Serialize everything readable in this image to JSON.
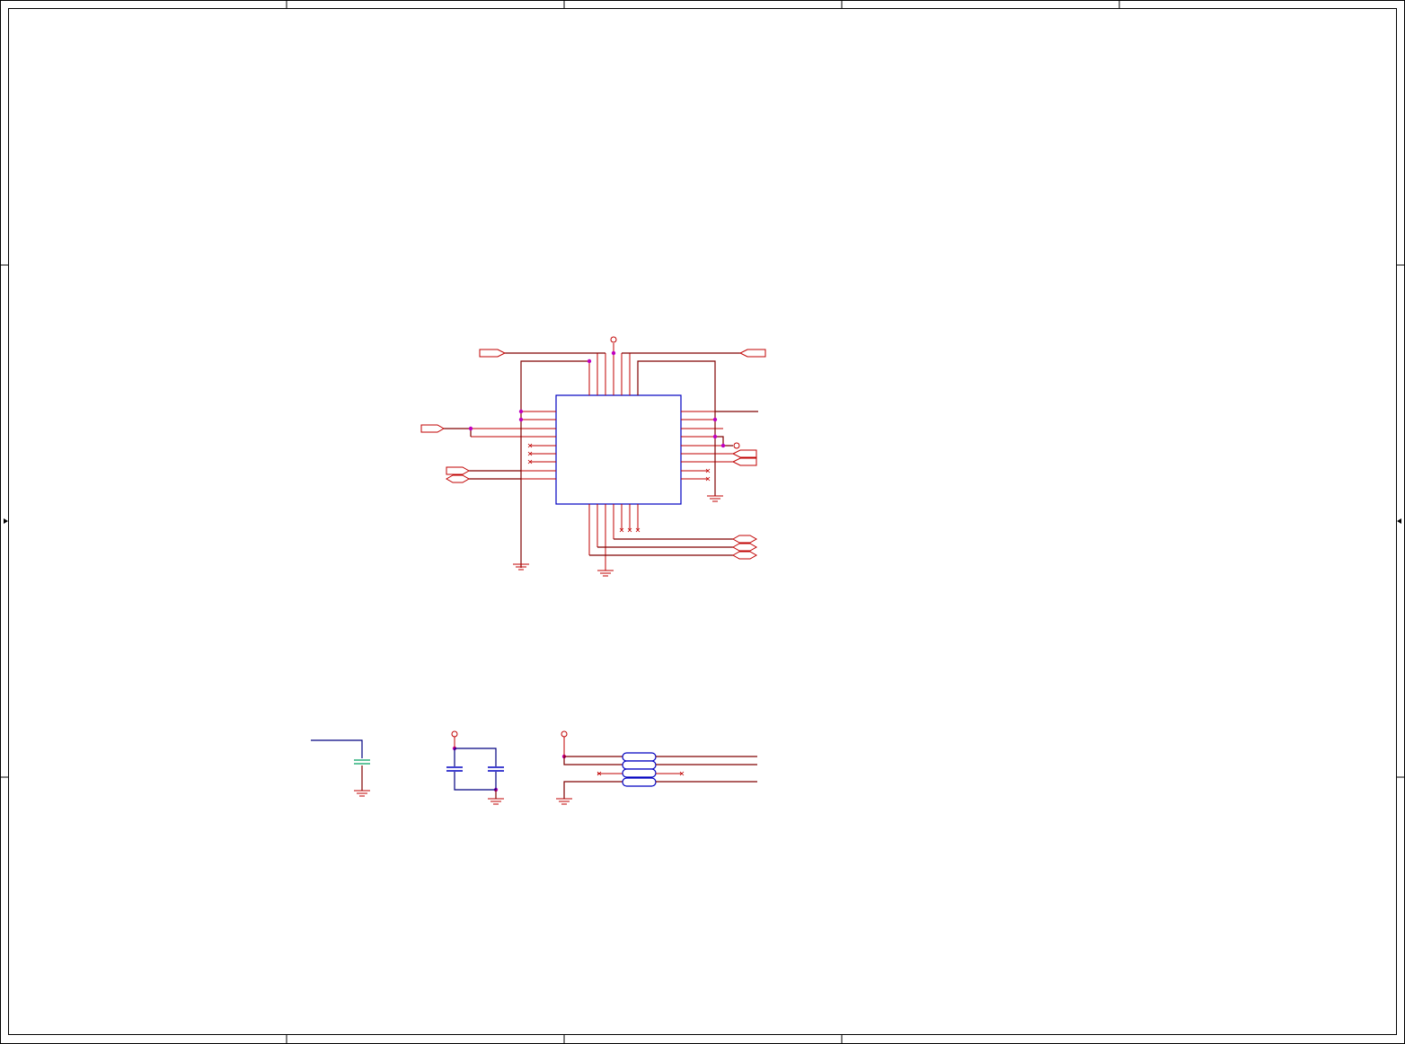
{
  "sheet": {
    "background": "#ffffff",
    "wire_color": "#800000",
    "symbol_color": "#0000c0",
    "junction_color": "#c000c0",
    "pin_color": "#c00000"
  }
}
